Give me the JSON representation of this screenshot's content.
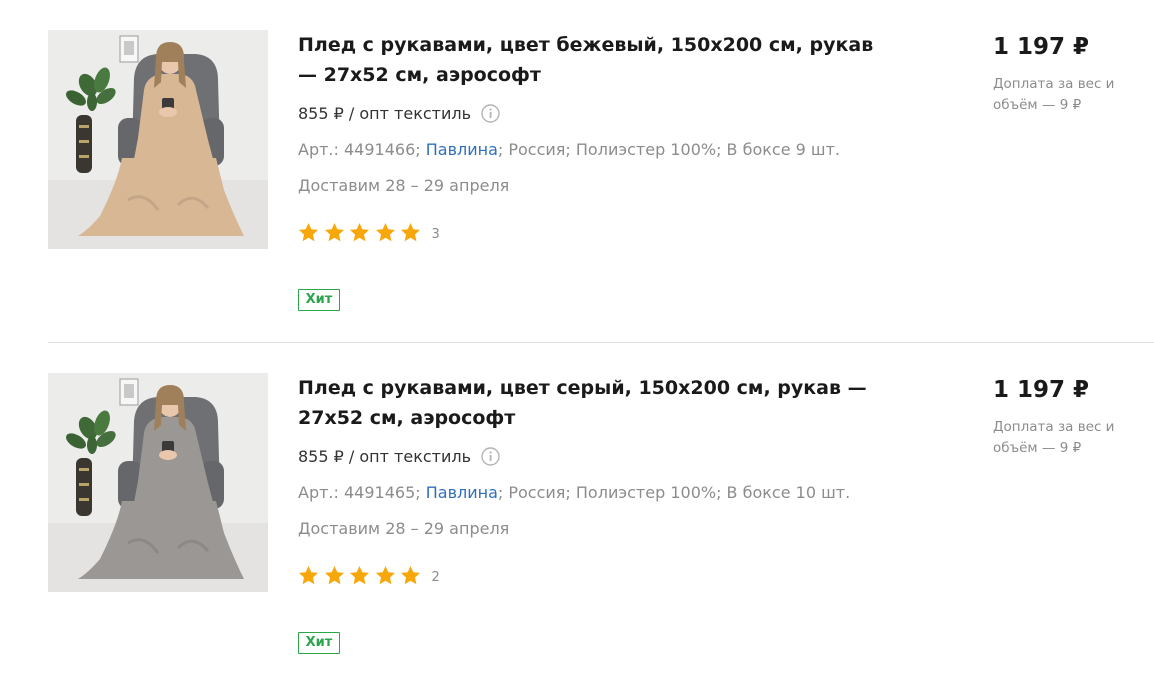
{
  "products": [
    {
      "image_alt": "Плед с рукавами, цвет бежевый",
      "title": "Плед с рукавами, цвет бежевый, 150х200 см, рукав — 27х52 см, аэрософт",
      "wholesale_price": "855 ₽ / опт текстиль",
      "article": "Арт.: 4491466;",
      "brand": "Павлина",
      "specs_rest": "; Россия; Полиэстер 100%; В боксе 9 шт.",
      "delivery": "Доставим 28 – 29 апреля",
      "rating": 5,
      "reviews_count": "3",
      "badge": "Хит",
      "price": "1 197 ₽",
      "surcharge": "Доплата за вес и объём — 9 ₽",
      "blanket_color": "#d8b795"
    },
    {
      "image_alt": "Плед с рукавами, цвет серый",
      "title": "Плед с рукавами, цвет серый, 150х200 см, рукав — 27х52 см, аэрософт",
      "wholesale_price": "855 ₽ / опт текстиль",
      "article": "Арт.: 4491465;",
      "brand": "Павлина",
      "specs_rest": "; Россия; Полиэстер 100%; В боксе 10 шт.",
      "delivery": "Доставим 28 – 29 апреля",
      "rating": 5,
      "reviews_count": "2",
      "badge": "Хит",
      "price": "1 197 ₽",
      "surcharge": "Доплата за вес и объём — 9 ₽",
      "blanket_color": "#9a9794"
    }
  ],
  "colors": {
    "star": "#f7a70a",
    "badge": "#2aa54b",
    "link": "#2f6fbd",
    "muted": "#8c8c8c"
  }
}
